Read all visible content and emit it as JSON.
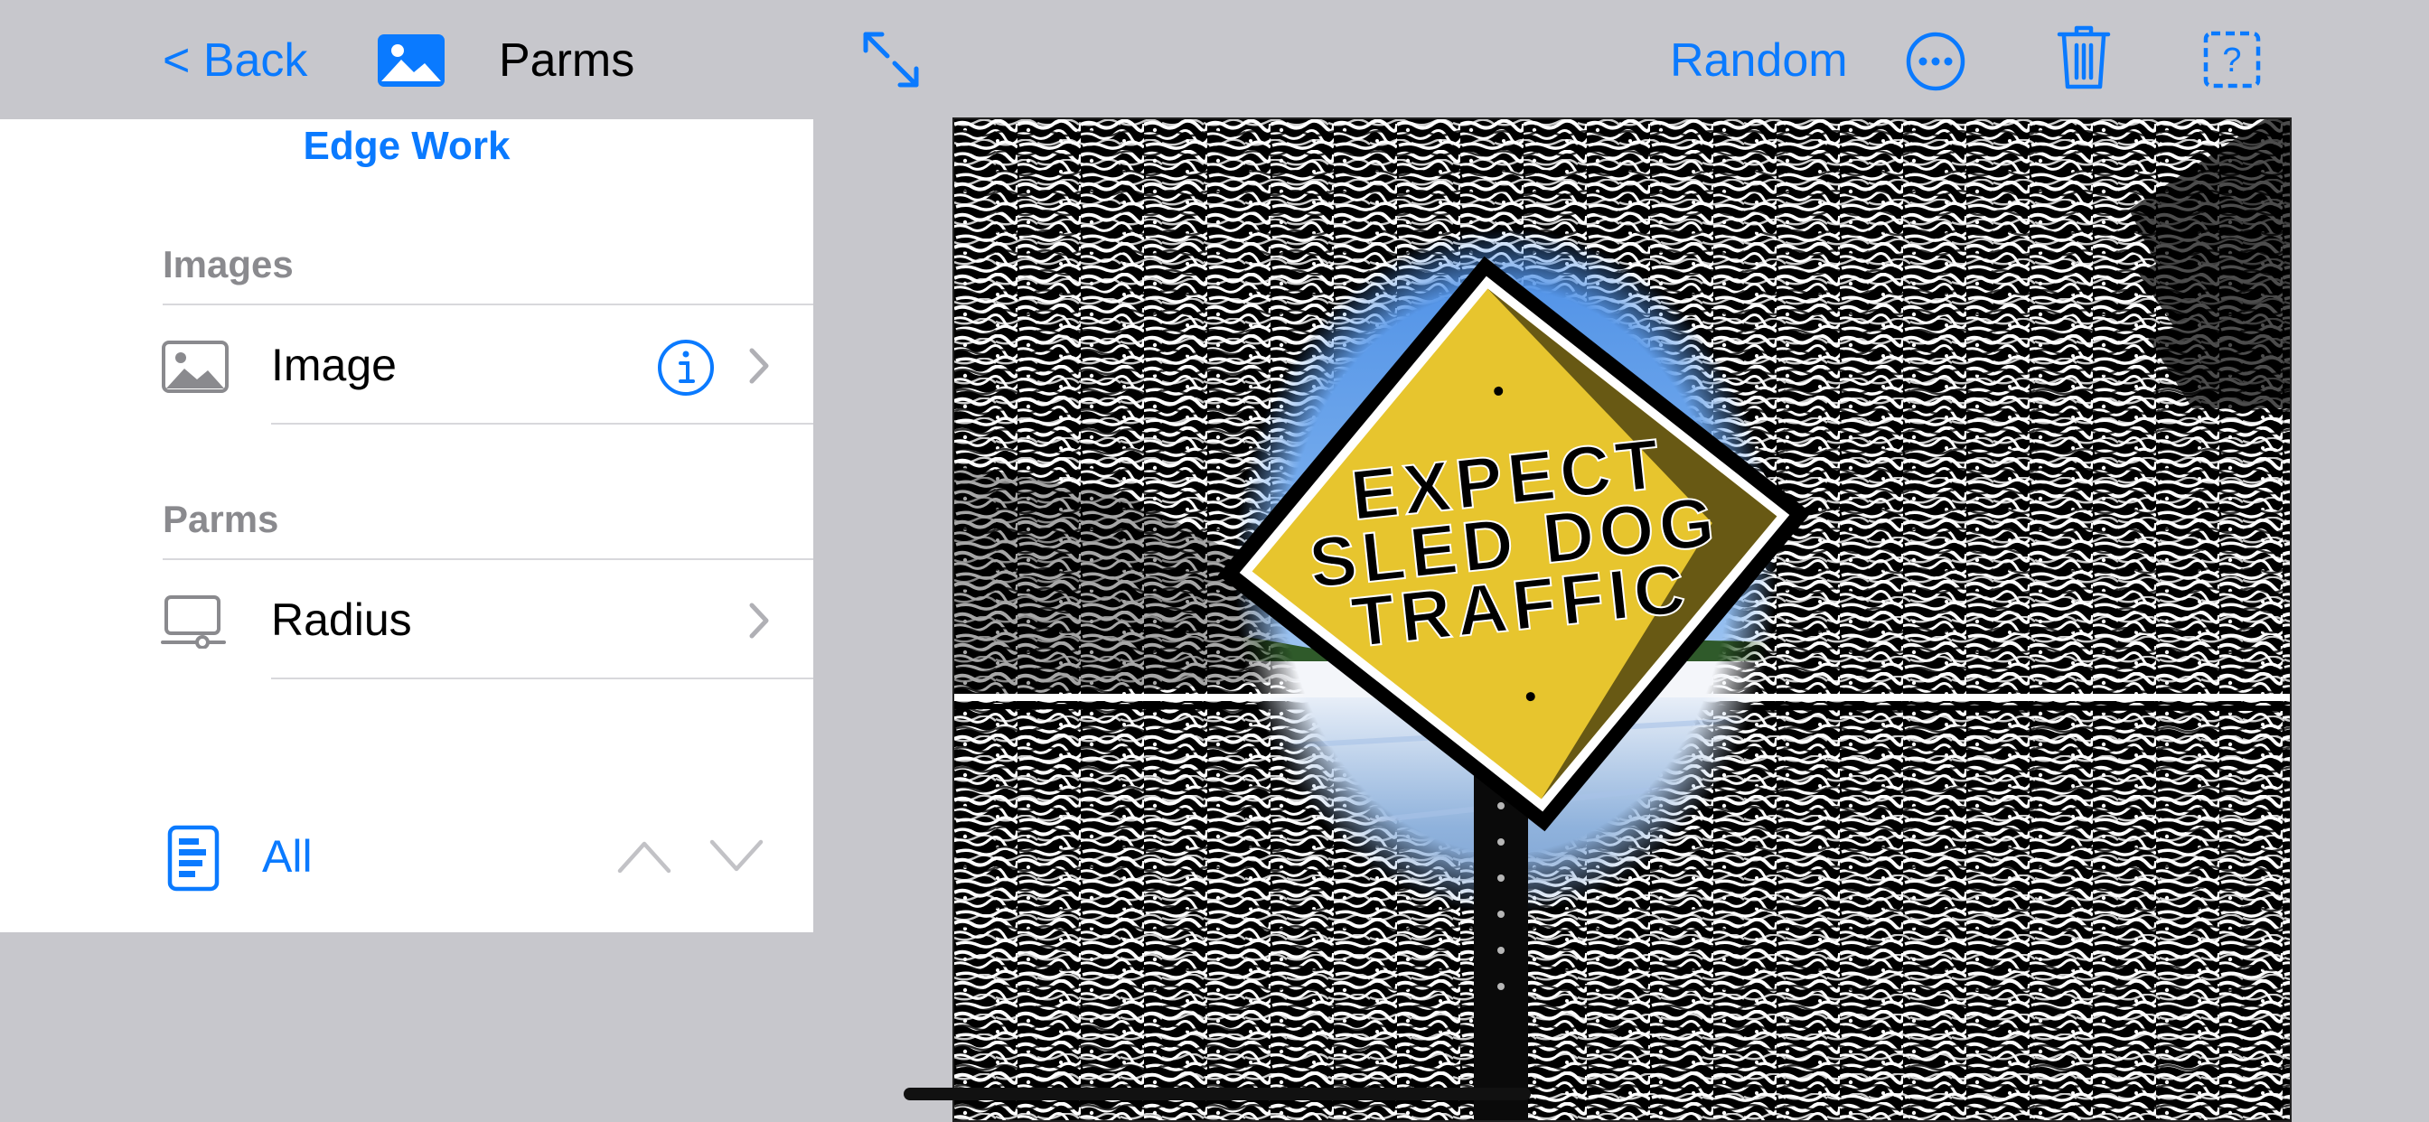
{
  "toolbar": {
    "back_label": "< Back",
    "title": "Parms",
    "random_label": "Random",
    "icons": {
      "photo": "photo-icon",
      "expand": "expand-icon",
      "more": "more-icon",
      "trash": "trash-icon",
      "help": "help-icon"
    }
  },
  "panel": {
    "title": "Edge Work",
    "sections": [
      {
        "header": "Images",
        "rows": [
          {
            "label": "Image",
            "icon": "photo-icon",
            "has_info": true
          }
        ]
      },
      {
        "header": "Parms",
        "rows": [
          {
            "label": "Radius",
            "icon": "slider-display-icon",
            "has_info": false
          }
        ]
      }
    ],
    "footer": {
      "label": "All",
      "icon": "document-list-icon"
    }
  },
  "preview": {
    "sign_text": [
      "EXPECT",
      "SLED DOG",
      "TRAFFIC"
    ]
  },
  "colors": {
    "accent": "#0a7aff",
    "background": "#c7c7cc",
    "panel": "#ffffff",
    "section_header": "#8a8a8e",
    "sign_yellow": "#e7c52e",
    "sky": "#5f9ee8"
  }
}
